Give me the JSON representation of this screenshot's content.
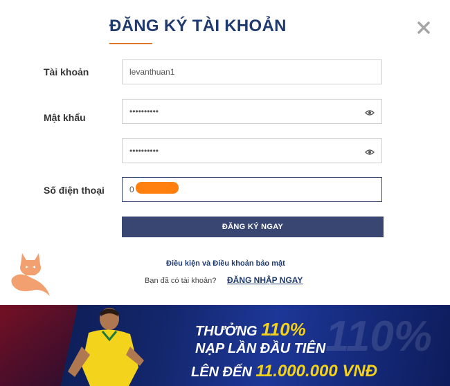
{
  "modal": {
    "title": "ĐĂNG KÝ TÀI KHOẢN",
    "close_icon": "close-icon"
  },
  "form": {
    "username": {
      "label": "Tài khoản",
      "value": "levanthuan1"
    },
    "password": {
      "label": "Mật khẩu",
      "value": "••••••••••",
      "icon": "eye-icon"
    },
    "confirm_password": {
      "value": "••••••••••",
      "icon": "eye-icon"
    },
    "phone": {
      "label": "Số điện thoại",
      "value": "0"
    },
    "submit_label": "ĐĂNG KÝ NGAY"
  },
  "footer": {
    "terms_link": "Điều kiện và Điều khoản bảo mật",
    "have_account": "Bạn đã có tài khoản?",
    "login_link": "ĐĂNG NHẬP NGAY"
  },
  "banner": {
    "line1_prefix": "THƯỞNG",
    "line1_value": "110%",
    "line2": "NẠP LẦN ĐẦU TIÊN",
    "line3_prefix": "LÊN ĐẾN",
    "line3_value": "11.000.000 VNĐ",
    "background_text": "110%"
  },
  "colors": {
    "primary": "#1f3a6e",
    "button": "#3a4672",
    "accent": "#e0762a",
    "banner_gold": "#f5d21a"
  }
}
